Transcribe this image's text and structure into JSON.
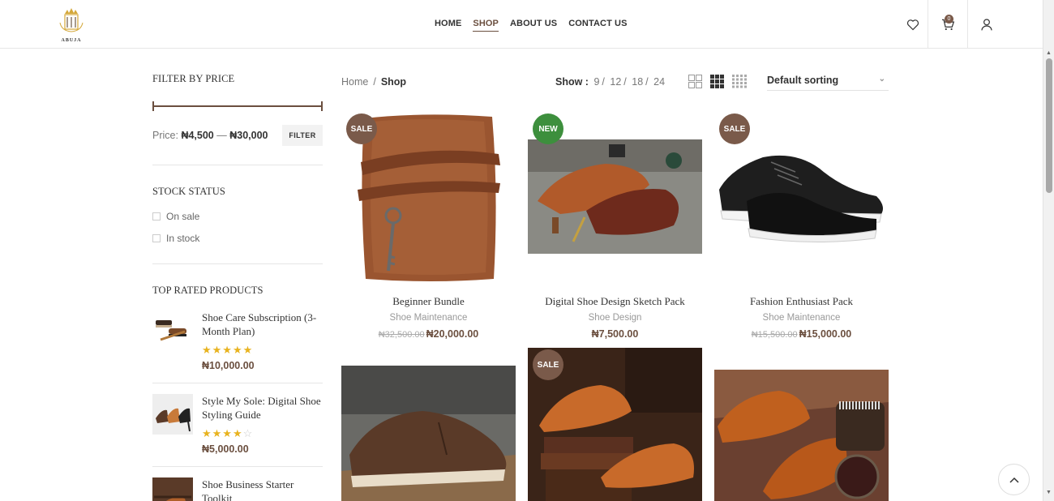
{
  "header": {
    "logo_text": "ABUJA",
    "nav": [
      {
        "label": "HOME"
      },
      {
        "label": "SHOP"
      },
      {
        "label": "ABOUT US"
      },
      {
        "label": "CONTACT US"
      }
    ],
    "cart_count": "0"
  },
  "sidebar": {
    "price_filter": {
      "title": "FILTER BY PRICE",
      "price_prefix": "Price:",
      "min": "₦4,500",
      "dash": "—",
      "max": "₦30,000",
      "button": "FILTER"
    },
    "stock": {
      "title": "STOCK STATUS",
      "options": [
        {
          "label": "On sale"
        },
        {
          "label": "In stock"
        }
      ]
    },
    "top_rated": {
      "title": "TOP RATED PRODUCTS",
      "items": [
        {
          "name": "Shoe Care Subscription (3-Month Plan)",
          "rating": 5,
          "stars": "★★★★★",
          "empty": "",
          "price": "₦10,000.00"
        },
        {
          "name": "Style My Sole: Digital Shoe Styling Guide",
          "rating": 4,
          "stars": "★★★★",
          "empty": "☆",
          "price": "₦5,000.00"
        },
        {
          "name": "Shoe Business Starter Toolkit"
        }
      ]
    }
  },
  "toolbar": {
    "breadcrumb_home": "Home",
    "breadcrumb_sep": "/",
    "breadcrumb_current": "Shop",
    "show_label": "Show :",
    "show_options": [
      "9",
      "12",
      "18",
      "24"
    ],
    "slash": "/",
    "sort_label": "Default sorting"
  },
  "products": [
    {
      "name": "Beginner Bundle",
      "category": "Shoe Maintenance",
      "old_price": "₦32,500.00",
      "price": "₦20,000.00",
      "badge": "SALE"
    },
    {
      "name": "Digital Shoe Design Sketch Pack",
      "category": "Shoe Design",
      "old_price": "",
      "price": "₦7,500.00",
      "badge": "NEW"
    },
    {
      "name": "Fashion Enthusiast Pack",
      "category": "Shoe Maintenance",
      "old_price": "₦15,500.00",
      "price": "₦15,000.00",
      "badge": "SALE"
    },
    {
      "badge": ""
    },
    {
      "badge": "SALE"
    },
    {
      "badge": ""
    }
  ],
  "colors": {
    "accent": "#6b4f3f",
    "sale_badge": "#7a5a4a",
    "new_badge": "#3d8f3d",
    "star": "#e8b31f"
  }
}
